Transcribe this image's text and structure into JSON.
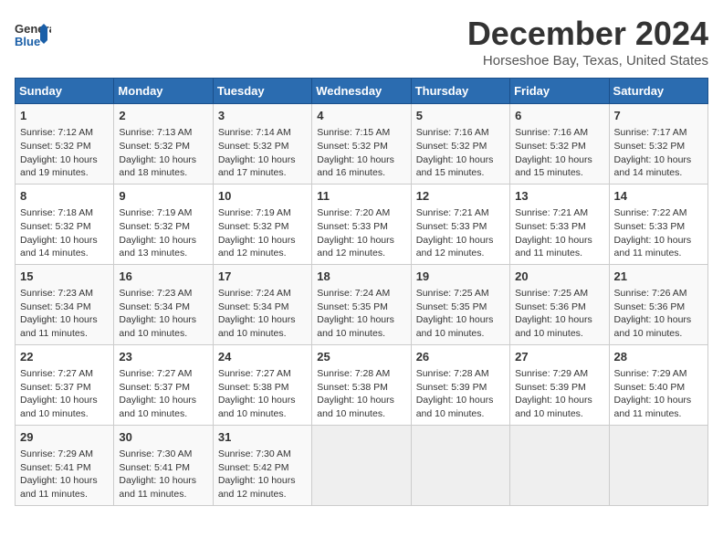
{
  "header": {
    "logo_general": "General",
    "logo_blue": "Blue",
    "title": "December 2024",
    "subtitle": "Horseshoe Bay, Texas, United States"
  },
  "calendar": {
    "days_of_week": [
      "Sunday",
      "Monday",
      "Tuesday",
      "Wednesday",
      "Thursday",
      "Friday",
      "Saturday"
    ],
    "weeks": [
      [
        {
          "day": "1",
          "sunrise": "Sunrise: 7:12 AM",
          "sunset": "Sunset: 5:32 PM",
          "daylight": "Daylight: 10 hours and 19 minutes."
        },
        {
          "day": "2",
          "sunrise": "Sunrise: 7:13 AM",
          "sunset": "Sunset: 5:32 PM",
          "daylight": "Daylight: 10 hours and 18 minutes."
        },
        {
          "day": "3",
          "sunrise": "Sunrise: 7:14 AM",
          "sunset": "Sunset: 5:32 PM",
          "daylight": "Daylight: 10 hours and 17 minutes."
        },
        {
          "day": "4",
          "sunrise": "Sunrise: 7:15 AM",
          "sunset": "Sunset: 5:32 PM",
          "daylight": "Daylight: 10 hours and 16 minutes."
        },
        {
          "day": "5",
          "sunrise": "Sunrise: 7:16 AM",
          "sunset": "Sunset: 5:32 PM",
          "daylight": "Daylight: 10 hours and 15 minutes."
        },
        {
          "day": "6",
          "sunrise": "Sunrise: 7:16 AM",
          "sunset": "Sunset: 5:32 PM",
          "daylight": "Daylight: 10 hours and 15 minutes."
        },
        {
          "day": "7",
          "sunrise": "Sunrise: 7:17 AM",
          "sunset": "Sunset: 5:32 PM",
          "daylight": "Daylight: 10 hours and 14 minutes."
        }
      ],
      [
        {
          "day": "8",
          "sunrise": "Sunrise: 7:18 AM",
          "sunset": "Sunset: 5:32 PM",
          "daylight": "Daylight: 10 hours and 14 minutes."
        },
        {
          "day": "9",
          "sunrise": "Sunrise: 7:19 AM",
          "sunset": "Sunset: 5:32 PM",
          "daylight": "Daylight: 10 hours and 13 minutes."
        },
        {
          "day": "10",
          "sunrise": "Sunrise: 7:19 AM",
          "sunset": "Sunset: 5:32 PM",
          "daylight": "Daylight: 10 hours and 12 minutes."
        },
        {
          "day": "11",
          "sunrise": "Sunrise: 7:20 AM",
          "sunset": "Sunset: 5:33 PM",
          "daylight": "Daylight: 10 hours and 12 minutes."
        },
        {
          "day": "12",
          "sunrise": "Sunrise: 7:21 AM",
          "sunset": "Sunset: 5:33 PM",
          "daylight": "Daylight: 10 hours and 12 minutes."
        },
        {
          "day": "13",
          "sunrise": "Sunrise: 7:21 AM",
          "sunset": "Sunset: 5:33 PM",
          "daylight": "Daylight: 10 hours and 11 minutes."
        },
        {
          "day": "14",
          "sunrise": "Sunrise: 7:22 AM",
          "sunset": "Sunset: 5:33 PM",
          "daylight": "Daylight: 10 hours and 11 minutes."
        }
      ],
      [
        {
          "day": "15",
          "sunrise": "Sunrise: 7:23 AM",
          "sunset": "Sunset: 5:34 PM",
          "daylight": "Daylight: 10 hours and 11 minutes."
        },
        {
          "day": "16",
          "sunrise": "Sunrise: 7:23 AM",
          "sunset": "Sunset: 5:34 PM",
          "daylight": "Daylight: 10 hours and 10 minutes."
        },
        {
          "day": "17",
          "sunrise": "Sunrise: 7:24 AM",
          "sunset": "Sunset: 5:34 PM",
          "daylight": "Daylight: 10 hours and 10 minutes."
        },
        {
          "day": "18",
          "sunrise": "Sunrise: 7:24 AM",
          "sunset": "Sunset: 5:35 PM",
          "daylight": "Daylight: 10 hours and 10 minutes."
        },
        {
          "day": "19",
          "sunrise": "Sunrise: 7:25 AM",
          "sunset": "Sunset: 5:35 PM",
          "daylight": "Daylight: 10 hours and 10 minutes."
        },
        {
          "day": "20",
          "sunrise": "Sunrise: 7:25 AM",
          "sunset": "Sunset: 5:36 PM",
          "daylight": "Daylight: 10 hours and 10 minutes."
        },
        {
          "day": "21",
          "sunrise": "Sunrise: 7:26 AM",
          "sunset": "Sunset: 5:36 PM",
          "daylight": "Daylight: 10 hours and 10 minutes."
        }
      ],
      [
        {
          "day": "22",
          "sunrise": "Sunrise: 7:27 AM",
          "sunset": "Sunset: 5:37 PM",
          "daylight": "Daylight: 10 hours and 10 minutes."
        },
        {
          "day": "23",
          "sunrise": "Sunrise: 7:27 AM",
          "sunset": "Sunset: 5:37 PM",
          "daylight": "Daylight: 10 hours and 10 minutes."
        },
        {
          "day": "24",
          "sunrise": "Sunrise: 7:27 AM",
          "sunset": "Sunset: 5:38 PM",
          "daylight": "Daylight: 10 hours and 10 minutes."
        },
        {
          "day": "25",
          "sunrise": "Sunrise: 7:28 AM",
          "sunset": "Sunset: 5:38 PM",
          "daylight": "Daylight: 10 hours and 10 minutes."
        },
        {
          "day": "26",
          "sunrise": "Sunrise: 7:28 AM",
          "sunset": "Sunset: 5:39 PM",
          "daylight": "Daylight: 10 hours and 10 minutes."
        },
        {
          "day": "27",
          "sunrise": "Sunrise: 7:29 AM",
          "sunset": "Sunset: 5:39 PM",
          "daylight": "Daylight: 10 hours and 10 minutes."
        },
        {
          "day": "28",
          "sunrise": "Sunrise: 7:29 AM",
          "sunset": "Sunset: 5:40 PM",
          "daylight": "Daylight: 10 hours and 11 minutes."
        }
      ],
      [
        {
          "day": "29",
          "sunrise": "Sunrise: 7:29 AM",
          "sunset": "Sunset: 5:41 PM",
          "daylight": "Daylight: 10 hours and 11 minutes."
        },
        {
          "day": "30",
          "sunrise": "Sunrise: 7:30 AM",
          "sunset": "Sunset: 5:41 PM",
          "daylight": "Daylight: 10 hours and 11 minutes."
        },
        {
          "day": "31",
          "sunrise": "Sunrise: 7:30 AM",
          "sunset": "Sunset: 5:42 PM",
          "daylight": "Daylight: 10 hours and 12 minutes."
        },
        null,
        null,
        null,
        null
      ]
    ]
  }
}
